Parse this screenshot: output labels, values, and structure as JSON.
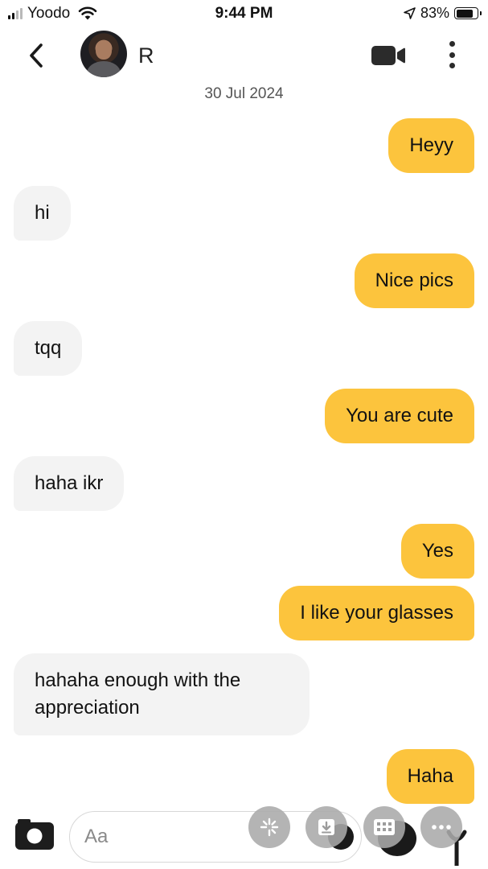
{
  "status_bar": {
    "carrier": "Yoodo",
    "time": "9:44 PM",
    "battery": "83%",
    "battery_level": 0.83,
    "icons": [
      "signal-icon",
      "wifi-icon",
      "location-arrow-icon",
      "battery-icon"
    ]
  },
  "header": {
    "contact_name": "R",
    "icons": [
      "chevron-left-icon",
      "video-camera-icon",
      "more-vertical-icon"
    ]
  },
  "date": "30 Jul 2024",
  "messages": [
    {
      "text": "Heyy",
      "from": "me"
    },
    {
      "text": "hi",
      "from": "them"
    },
    {
      "text": "Nice pics",
      "from": "me"
    },
    {
      "text": "tqq",
      "from": "them"
    },
    {
      "text": "You are cute",
      "from": "me"
    },
    {
      "text": "haha ikr",
      "from": "them"
    },
    {
      "text": "Yes",
      "from": "me"
    },
    {
      "text": "I like your glasses",
      "from": "me"
    },
    {
      "text": "hahaha enough with the appreciation",
      "from": "them"
    },
    {
      "text": "Haha",
      "from": "me"
    }
  ],
  "composer": {
    "placeholder": "Aa",
    "icons": [
      "camera-icon",
      "sparkle-icon",
      "download-icon",
      "grid-icon",
      "more-horizontal-icon"
    ]
  },
  "colors": {
    "outgoing_bubble": "#fcc43d",
    "incoming_bubble": "#f3f3f3",
    "background": "#ffffff"
  }
}
